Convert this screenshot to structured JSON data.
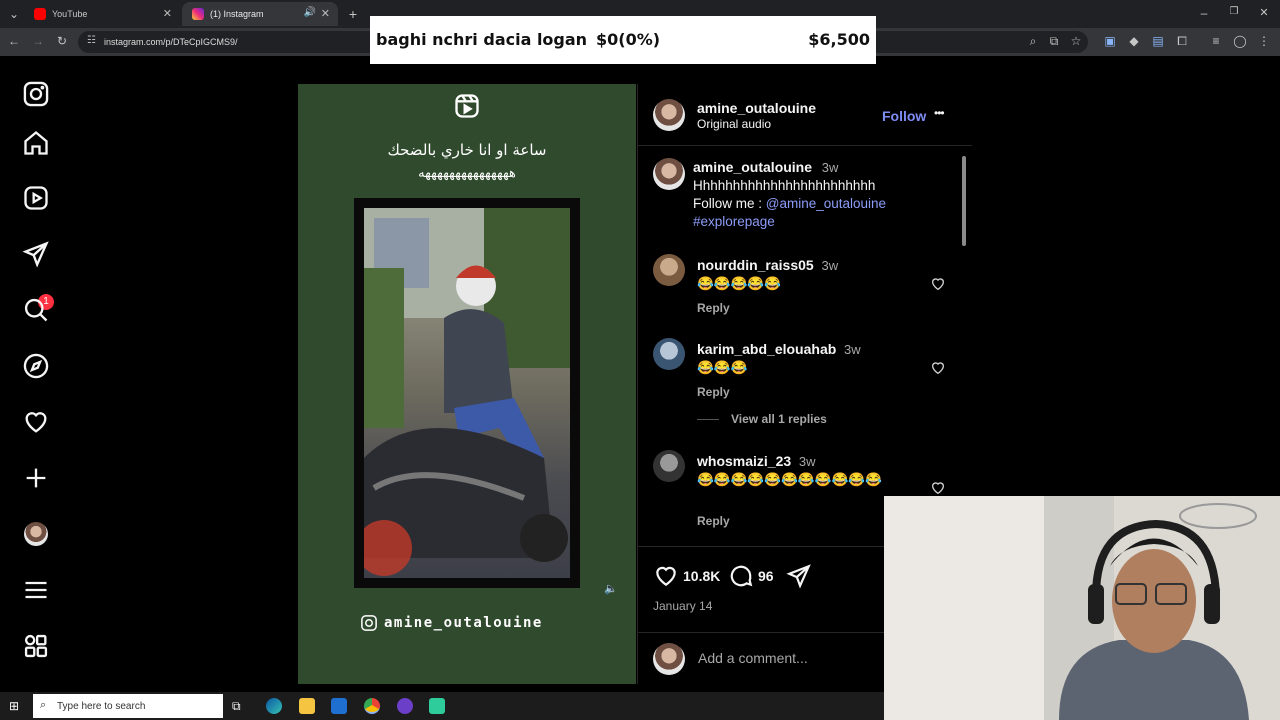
{
  "browser": {
    "tabs": [
      {
        "label": "YouTube",
        "active": false
      },
      {
        "label": "(1) Instagram",
        "active": true
      }
    ],
    "new_tab": "+",
    "url": "instagram.com/p/DTeCpIGCMS9/",
    "window_controls": [
      "–",
      "❐",
      "✕"
    ]
  },
  "overlay": {
    "goal_text": "baghi nchri dacia logan",
    "progress_text": "$0(0%)",
    "goal_amount": "$6,500",
    "progress_fraction": 0
  },
  "nav": {
    "notification_count": "1",
    "items": [
      "instagram-logo",
      "home",
      "reels",
      "messages",
      "search",
      "explore",
      "notifications",
      "create",
      "profile",
      "more",
      "also-from-meta"
    ]
  },
  "post": {
    "media": {
      "overlay_title": "ساعة او انا خاري بالضحك",
      "overlay_laugh": "هههههههههههههههه",
      "watermark_handle": "amine_outalouine"
    },
    "author": {
      "username": "amine_outalouine",
      "audio": "Original audio",
      "follow_label": "Follow",
      "more_label": "•••"
    },
    "caption": {
      "username": "amine_outalouine",
      "time": "3w",
      "text": "Hhhhhhhhhhhhhhhhhhhhhhhh",
      "follow_prefix": "Follow me : ",
      "mention": "@amine_outalouine",
      "hashtag": "#explorepage"
    },
    "comments": [
      {
        "username": "nourddin_raiss05",
        "time": "3w",
        "text": "😂😂😂😂😂",
        "reply_label": "Reply"
      },
      {
        "username": "karim_abd_elouahab",
        "time": "3w",
        "text": "😂😂😂",
        "reply_label": "Reply",
        "view_replies": "View all 1 replies"
      },
      {
        "username": "whosmaizi_23",
        "time": "3w",
        "text": "😂😂😂😂😂😂😂😂😂😂😂",
        "reply_label": "Reply"
      }
    ],
    "stats": {
      "likes": "10.8K",
      "comments": "96",
      "date": "January 14"
    },
    "add_comment_placeholder": "Add a comment..."
  },
  "taskbar": {
    "search_placeholder": "Type here to search"
  }
}
